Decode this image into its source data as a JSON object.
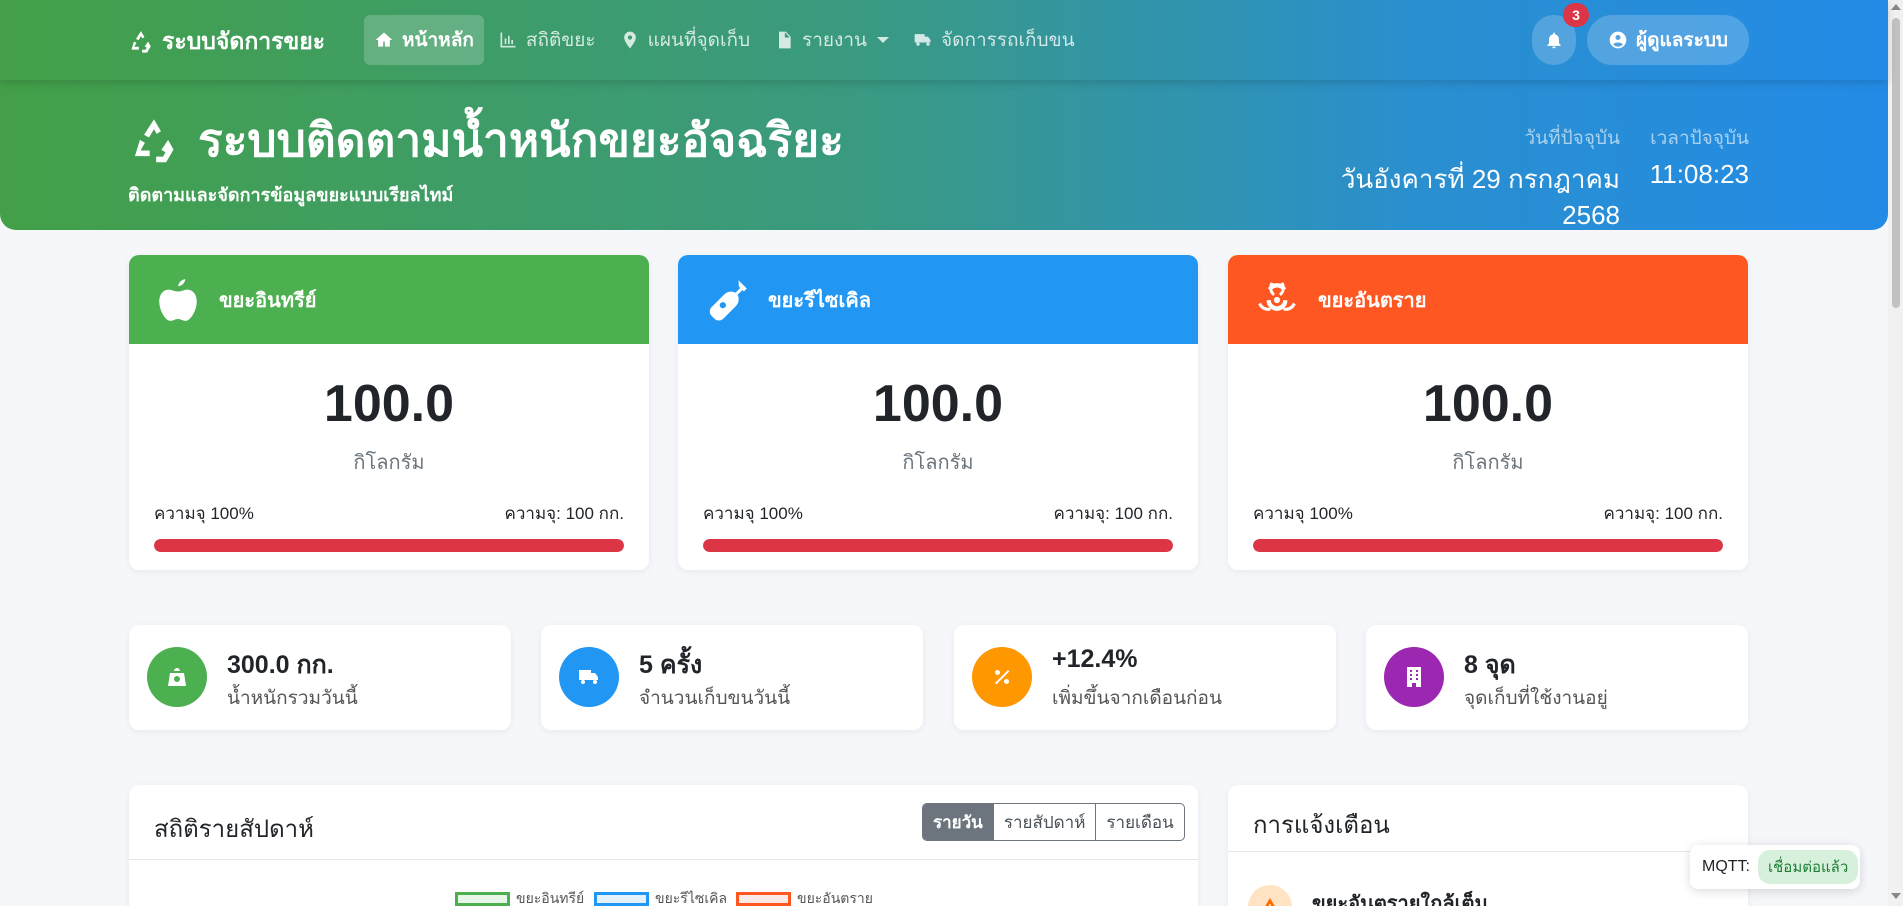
{
  "nav": {
    "brand": "ระบบจัดการขยะ",
    "items": [
      {
        "label": "หน้าหลัก",
        "icon": "home-icon",
        "active": true
      },
      {
        "label": "สถิติขยะ",
        "icon": "chart-icon",
        "active": false
      },
      {
        "label": "แผนที่จุดเก็บ",
        "icon": "map-pin-icon",
        "active": false
      },
      {
        "label": "รายงาน",
        "icon": "file-icon",
        "active": false,
        "dropdown": true
      },
      {
        "label": "จัดการรถเก็บขน",
        "icon": "truck-icon",
        "active": false
      }
    ],
    "notification_count": "3",
    "user_label": "ผู้ดูแลระบบ"
  },
  "hero": {
    "title": "ระบบติดตามน้ำหนักขยะอัจฉริยะ",
    "subtitle": "ติดตามและจัดการข้อมูลขยะแบบเรียลไทม์",
    "date_label": "วันที่ปัจจุบัน",
    "date_value": "วันอังคารที่ 29 กรกฎาคม 2568",
    "time_label": "เวลาปัจจุบัน",
    "time_value": "11:08:23"
  },
  "waste_cards": [
    {
      "name": "ขยะอินทรีย์",
      "icon": "apple-icon",
      "color": "#4caf50",
      "value": "100.0",
      "unit": "กิโลกรัม",
      "fill_label": "ความจุ 100%",
      "capacity_label": "ความจุ: 100 กก.",
      "fill_pct": 100
    },
    {
      "name": "ขยะรีไซเคิล",
      "icon": "bottle-icon",
      "color": "#2196f3",
      "value": "100.0",
      "unit": "กิโลกรัม",
      "fill_label": "ความจุ 100%",
      "capacity_label": "ความจุ: 100 กก.",
      "fill_pct": 100
    },
    {
      "name": "ขยะอันตราย",
      "icon": "biohazard-icon",
      "color": "#ff5722",
      "value": "100.0",
      "unit": "กิโลกรัม",
      "fill_label": "ความจุ 100%",
      "capacity_label": "ความจุ: 100 กก.",
      "fill_pct": 100
    }
  ],
  "stats": [
    {
      "value": "300.0 กก.",
      "label": "น้ำหนักรวมวันนี้",
      "icon": "weight-icon",
      "color": "#4caf50"
    },
    {
      "value": "5 ครั้ง",
      "label": "จำนวนเก็บขนวันนี้",
      "icon": "truck-icon",
      "color": "#2196f3"
    },
    {
      "value": "+12.4%",
      "label": "เพิ่มขึ้นจากเดือนก่อน",
      "icon": "percent-icon",
      "color": "#ff9800"
    },
    {
      "value": "8 จุด",
      "label": "จุดเก็บที่ใช้งานอยู่",
      "icon": "building-icon",
      "color": "#9c27b0"
    }
  ],
  "weekly": {
    "title": "สถิติรายสัปดาห์",
    "tabs": [
      "รายวัน",
      "รายสัปดาห์",
      "รายเดือน"
    ],
    "legend": [
      {
        "label": "ขยะอินทรีย์",
        "color": "#4caf50"
      },
      {
        "label": "ขยะรีไซเคิล",
        "color": "#2196f3"
      },
      {
        "label": "ขยะอันตราย",
        "color": "#ff5722"
      }
    ]
  },
  "alerts": {
    "title": "การแจ้งเตือน",
    "items": [
      {
        "title": "ขยะอันตรายใกล้เต็ม",
        "icon": "warning-icon"
      }
    ]
  },
  "mqtt": {
    "label": "MQTT:",
    "status": "เชื่อมต่อแล้ว"
  }
}
